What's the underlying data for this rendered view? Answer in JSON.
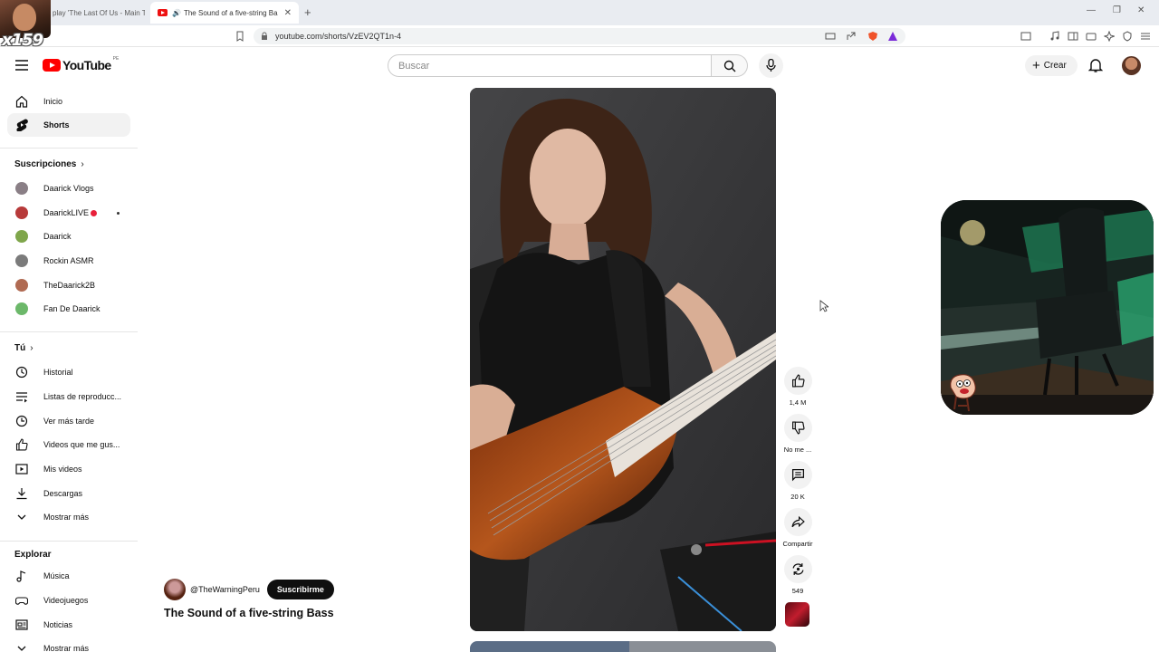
{
  "browser": {
    "tabs": [
      {
        "title": "play 'The Last Of Us - Main T"
      },
      {
        "title": "The Sound of a five-string Ba"
      }
    ],
    "url": "youtube.com/shorts/VzEV2QT1n-4"
  },
  "overlay": {
    "sub_counter": "x159"
  },
  "header": {
    "logo_text": "YouTube",
    "country_code": "PE",
    "search_placeholder": "Buscar",
    "create_label": "Crear"
  },
  "sidebar": {
    "main_items": [
      {
        "label": "Inicio",
        "icon": "home-icon"
      },
      {
        "label": "Shorts",
        "icon": "shorts-icon",
        "active": true
      }
    ],
    "subscriptions_title": "Suscripciones",
    "subscriptions": [
      {
        "label": "Daarick Vlogs",
        "color": "#8a7f86"
      },
      {
        "label": "DaarickLIVE",
        "color": "#b73a3a",
        "live": true
      },
      {
        "label": "Daarick",
        "color": "#7fa64b"
      },
      {
        "label": "Rockin ASMR",
        "color": "#7b7b7b"
      },
      {
        "label": "TheDaarick2B",
        "color": "#b06a52"
      },
      {
        "label": "Fan De Daarick",
        "color": "#6cb86a"
      }
    ],
    "you_title": "Tú",
    "you_items": [
      {
        "label": "Historial",
        "icon": "history-icon"
      },
      {
        "label": "Listas de reproducc...",
        "icon": "playlist-icon"
      },
      {
        "label": "Ver más tarde",
        "icon": "watch-later-icon"
      },
      {
        "label": "Videos que me gus...",
        "icon": "thumbs-up-icon"
      },
      {
        "label": "Mis videos",
        "icon": "my-videos-icon"
      },
      {
        "label": "Descargas",
        "icon": "download-icon"
      },
      {
        "label": "Mostrar más",
        "icon": "chevron-down-icon"
      }
    ],
    "explore_title": "Explorar",
    "explore_items": [
      {
        "label": "Música",
        "icon": "music-icon"
      },
      {
        "label": "Videojuegos",
        "icon": "gaming-icon"
      },
      {
        "label": "Noticias",
        "icon": "news-icon"
      },
      {
        "label": "Mostrar más",
        "icon": "chevron-down-icon"
      }
    ]
  },
  "short": {
    "channel": "@TheWarningPeru",
    "subscribe_label": "Suscribirme",
    "title": "The Sound of a five-string Bass",
    "actions": {
      "likes": "1,4 M",
      "dislike_label": "No me ...",
      "comments": "20 K",
      "share_label": "Compartir",
      "remix_count": "549"
    }
  }
}
